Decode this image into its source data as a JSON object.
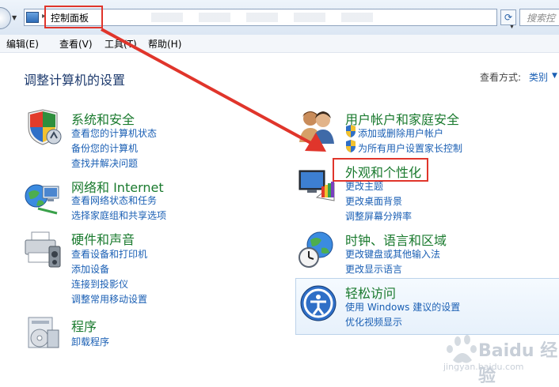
{
  "address_bar": {
    "path": "控制面板",
    "separator": "▸",
    "search_placeholder": "搜索控"
  },
  "menu": {
    "items": [
      "编辑(E)",
      "查看(V)",
      "工具(T)",
      "帮助(H)"
    ]
  },
  "content": {
    "heading": "调整计算机的设置",
    "view_by_label": "查看方式:",
    "view_by_value": "类别"
  },
  "categories": {
    "system": {
      "title": "系统和安全",
      "links": [
        "查看您的计算机状态",
        "备份您的计算机",
        "查找并解决问题"
      ]
    },
    "network": {
      "title": "网络和 Internet",
      "links": [
        "查看网络状态和任务",
        "选择家庭组和共享选项"
      ]
    },
    "hardware": {
      "title": "硬件和声音",
      "links": [
        "查看设备和打印机",
        "添加设备",
        "连接到投影仪",
        "调整常用移动设置"
      ]
    },
    "programs": {
      "title": "程序",
      "links": [
        "卸载程序"
      ]
    },
    "users": {
      "title": "用户帐户和家庭安全",
      "links": [
        "添加或删除用户帐户",
        "为所有用户设置家长控制"
      ]
    },
    "appearance": {
      "title": "外观和个性化",
      "links": [
        "更改主题",
        "更改桌面背景",
        "调整屏幕分辨率"
      ]
    },
    "clock": {
      "title": "时钟、语言和区域",
      "links": [
        "更改键盘或其他输入法",
        "更改显示语言"
      ]
    },
    "ease": {
      "title": "轻松访问",
      "links": [
        "使用 Windows 建议的设置",
        "优化视频显示"
      ]
    }
  },
  "watermark": {
    "brand": "Baidu 经验",
    "url": "jingyan.baidu.com"
  },
  "colors": {
    "highlight_red": "#e0352b",
    "link_blue": "#1a5fb4",
    "category_green": "#1a7a2e"
  }
}
